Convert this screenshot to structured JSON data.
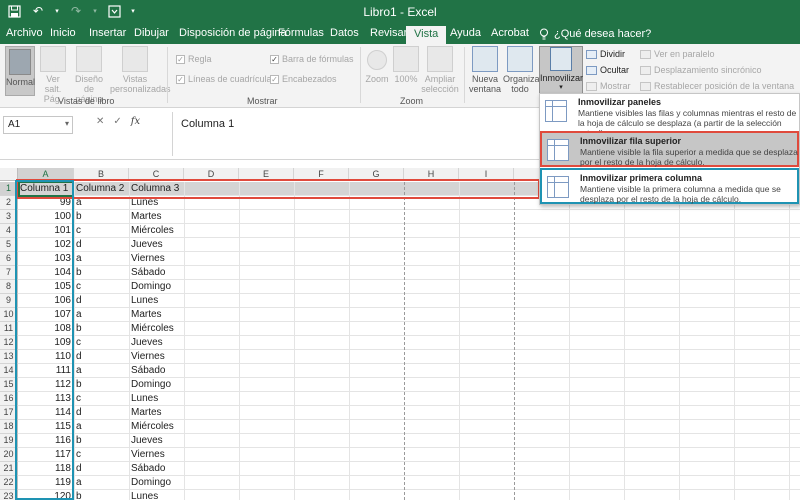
{
  "window": {
    "title": "Libro1  -  Excel"
  },
  "qat": {
    "save": "save-icon",
    "undo": "undo-icon",
    "redo": "redo-icon",
    "customize": "customize-icon"
  },
  "tabs": [
    "Archivo",
    "Inicio",
    "Insertar",
    "Dibujar",
    "Disposición de página",
    "Fórmulas",
    "Datos",
    "Revisar",
    "Vista",
    "Ayuda",
    "Acrobat"
  ],
  "active_tab": "Vista",
  "tell_me": "¿Qué desea hacer?",
  "ribbon": {
    "vistas_libro": {
      "label": "Vistas de libro",
      "normal": "Normal",
      "salto": "Ver salt. Pág.",
      "diseno": "Diseño de página",
      "personalizadas": "Vistas personalizadas"
    },
    "mostrar": {
      "label": "Mostrar",
      "regla": "Regla",
      "lineas": "Líneas de cuadrícula",
      "barra": "Barra de fórmulas",
      "encabezados": "Encabezados"
    },
    "zoom": {
      "label": "Zoom",
      "zoom": "Zoom",
      "cien": "100%",
      "ampliar": "Ampliar selección"
    },
    "ventana": {
      "nueva": "Nueva ventana",
      "organizar": "Organizar todo",
      "inmovilizar": "Inmovilizar",
      "dividir": "Dividir",
      "ocultar": "Ocultar",
      "mostrar": "Mostrar",
      "en_paralelo": "Ver en paralelo",
      "sincronico": "Desplazamiento sincrónico",
      "restablecer": "Restablecer posición de la ventana"
    }
  },
  "formula_bar": {
    "name_box": "A1",
    "content": "Columna 1",
    "cancel": "✕",
    "enter": "✓",
    "fx": "fx"
  },
  "columns": [
    "A",
    "B",
    "C",
    "D",
    "E",
    "F",
    "G",
    "H",
    "I"
  ],
  "header_row": [
    "Columna 1",
    "Columna 2",
    "Columna 3"
  ],
  "rows": [
    [
      "99",
      "a",
      "Lunes"
    ],
    [
      "100",
      "b",
      "Martes"
    ],
    [
      "101",
      "c",
      "Miércoles"
    ],
    [
      "102",
      "d",
      "Jueves"
    ],
    [
      "103",
      "a",
      "Viernes"
    ],
    [
      "104",
      "b",
      "Sábado"
    ],
    [
      "105",
      "c",
      "Domingo"
    ],
    [
      "106",
      "d",
      "Lunes"
    ],
    [
      "107",
      "a",
      "Martes"
    ],
    [
      "108",
      "b",
      "Miércoles"
    ],
    [
      "109",
      "c",
      "Jueves"
    ],
    [
      "110",
      "d",
      "Viernes"
    ],
    [
      "111",
      "a",
      "Sábado"
    ],
    [
      "112",
      "b",
      "Domingo"
    ],
    [
      "113",
      "c",
      "Lunes"
    ],
    [
      "114",
      "d",
      "Martes"
    ],
    [
      "115",
      "a",
      "Miércoles"
    ],
    [
      "116",
      "b",
      "Jueves"
    ],
    [
      "117",
      "c",
      "Viernes"
    ],
    [
      "118",
      "d",
      "Sábado"
    ],
    [
      "119",
      "a",
      "Domingo"
    ],
    [
      "120",
      "b",
      "Lunes"
    ]
  ],
  "dropdown": {
    "options": [
      {
        "title": "Inmovilizar paneles",
        "desc": "Mantiene visibles las filas y columnas mientras el resto de la hoja de cálculo se desplaza (a partir de la selección actual).",
        "icon": "freeze-panes-icon"
      },
      {
        "title": "Inmovilizar fila superior",
        "desc": "Mantiene visible la fila superior a medida que se desplaza por el resto de la hoja de cálculo.",
        "icon": "freeze-top-row-icon"
      },
      {
        "title": "Inmovilizar primera columna",
        "desc": "Mantiene visible la primera columna a medida que se desplaza por el resto de la hoja de cálculo.",
        "icon": "freeze-first-column-icon"
      }
    ]
  },
  "colors": {
    "excel_green": "#217346",
    "highlight_red": "#e04a3c",
    "highlight_teal": "#1e93b3"
  }
}
